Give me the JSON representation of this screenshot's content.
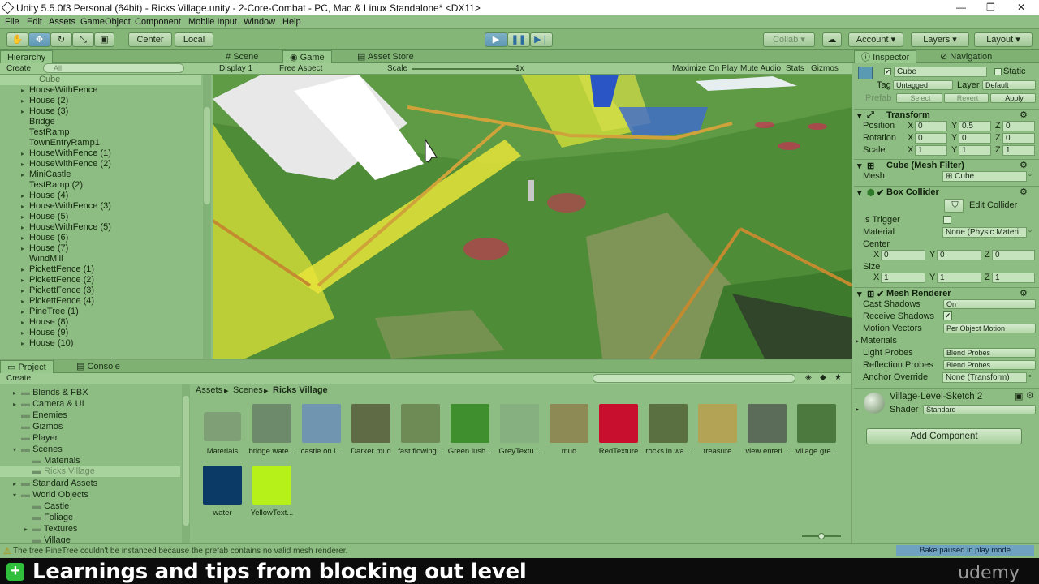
{
  "window": {
    "title": "Unity 5.5.0f3 Personal (64bit) - Ricks Village.unity - 2-Core-Combat - PC, Mac & Linux Standalone* <DX11>",
    "controls": [
      "—",
      "❐",
      "✕"
    ]
  },
  "menu": [
    "File",
    "Edit",
    "Assets",
    "GameObject",
    "Component",
    "Mobile Input",
    "Window",
    "Help"
  ],
  "toolbar": {
    "pivot_center": "Center",
    "pivot_local": "Local",
    "collab": "Collab",
    "account": "Account",
    "layers": "Layers",
    "layout": "Layout"
  },
  "hierarchy": {
    "tab": "Hierarchy",
    "create": "Create",
    "search_placeholder": "All",
    "selected": "Cube",
    "items": [
      {
        "label": "HouseWithFence",
        "expandable": true
      },
      {
        "label": "House (2)",
        "expandable": true
      },
      {
        "label": "House (3)",
        "expandable": true
      },
      {
        "label": "Bridge",
        "expandable": false
      },
      {
        "label": "TestRamp",
        "expandable": false
      },
      {
        "label": "TownEntryRamp1",
        "expandable": false
      },
      {
        "label": "HouseWithFence (1)",
        "expandable": true
      },
      {
        "label": "HouseWithFence (2)",
        "expandable": true
      },
      {
        "label": "MiniCastle",
        "expandable": true
      },
      {
        "label": "TestRamp (2)",
        "expandable": false
      },
      {
        "label": "House (4)",
        "expandable": true
      },
      {
        "label": "HouseWithFence (3)",
        "expandable": true
      },
      {
        "label": "House (5)",
        "expandable": true
      },
      {
        "label": "HouseWithFence (5)",
        "expandable": true
      },
      {
        "label": "House (6)",
        "expandable": true
      },
      {
        "label": "House (7)",
        "expandable": true
      },
      {
        "label": "WindMill",
        "expandable": false
      },
      {
        "label": "PickettFence (1)",
        "expandable": true
      },
      {
        "label": "PickettFence (2)",
        "expandable": true
      },
      {
        "label": "PickettFence (3)",
        "expandable": true
      },
      {
        "label": "PickettFence (4)",
        "expandable": true
      },
      {
        "label": "PineTree (1)",
        "expandable": true
      },
      {
        "label": "House (8)",
        "expandable": true
      },
      {
        "label": "House (9)",
        "expandable": true
      },
      {
        "label": "House (10)",
        "expandable": true
      }
    ]
  },
  "center_tabs": {
    "scene": "Scene",
    "game": "Game",
    "asset_store": "Asset Store"
  },
  "game_bar": {
    "display": "Display 1",
    "aspect": "Free Aspect",
    "scale_label": "Scale",
    "scale_value": "1x",
    "maximize": "Maximize On Play",
    "mute": "Mute Audio",
    "stats": "Stats",
    "gizmos": "Gizmos"
  },
  "inspector": {
    "tab": "Inspector",
    "nav_tab": "Navigation",
    "object_name": "Cube",
    "static_label": "Static",
    "tag_label": "Tag",
    "tag_value": "Untagged",
    "layer_label": "Layer",
    "layer_value": "Default",
    "prefab_label": "Prefab",
    "select": "Select",
    "revert": "Revert",
    "apply": "Apply",
    "transform": {
      "title": "Transform",
      "rows": [
        {
          "label": "Position",
          "x": "0",
          "y": "0.5",
          "z": "0"
        },
        {
          "label": "Rotation",
          "x": "0",
          "y": "0",
          "z": "0"
        },
        {
          "label": "Scale",
          "x": "1",
          "y": "1",
          "z": "1"
        }
      ]
    },
    "mesh_filter": {
      "title": "Cube (Mesh Filter)",
      "mesh_label": "Mesh",
      "mesh_value": "Cube"
    },
    "box_collider": {
      "title": "Box Collider",
      "edit": "Edit Collider",
      "is_trigger": "Is Trigger",
      "material_label": "Material",
      "material_value": "None (Physic Materi.",
      "center_label": "Center",
      "center": {
        "x": "0",
        "y": "0",
        "z": "0"
      },
      "size_label": "Size",
      "size": {
        "x": "1",
        "y": "1",
        "z": "1"
      }
    },
    "mesh_renderer": {
      "title": "Mesh Renderer",
      "rows": [
        {
          "label": "Cast Shadows",
          "value": "On",
          "kind": "dropdown"
        },
        {
          "label": "Receive Shadows",
          "value": "✔",
          "kind": "check"
        },
        {
          "label": "Motion Vectors",
          "value": "Per Object Motion",
          "kind": "dropdown"
        },
        {
          "label": "Materials",
          "value": "",
          "kind": "fold"
        },
        {
          "label": "Light Probes",
          "value": "Blend Probes",
          "kind": "dropdown"
        },
        {
          "label": "Reflection Probes",
          "value": "Blend Probes",
          "kind": "dropdown"
        },
        {
          "label": "Anchor Override",
          "value": "None (Transform)",
          "kind": "field"
        }
      ]
    },
    "material": {
      "name": "Village-Level-Sketch 2",
      "shader_label": "Shader",
      "shader_value": "Standard"
    },
    "add_component": "Add Component"
  },
  "project": {
    "tab": "Project",
    "console_tab": "Console",
    "create": "Create",
    "tree": [
      {
        "label": "Blends & FBX",
        "depth": 1,
        "arrow": "▸"
      },
      {
        "label": "Camera & UI",
        "depth": 1,
        "arrow": "▸"
      },
      {
        "label": "Enemies",
        "depth": 1,
        "arrow": ""
      },
      {
        "label": "Gizmos",
        "depth": 1,
        "arrow": ""
      },
      {
        "label": "Player",
        "depth": 1,
        "arrow": ""
      },
      {
        "label": "Scenes",
        "depth": 1,
        "arrow": "▾"
      },
      {
        "label": "Materials",
        "depth": 2,
        "arrow": ""
      },
      {
        "label": "Ricks Village",
        "depth": 2,
        "arrow": ""
      },
      {
        "label": "Standard Assets",
        "depth": 1,
        "arrow": "▸"
      },
      {
        "label": "World Objects",
        "depth": 1,
        "arrow": "▾"
      },
      {
        "label": "Castle",
        "depth": 2,
        "arrow": ""
      },
      {
        "label": "Foliage",
        "depth": 2,
        "arrow": ""
      },
      {
        "label": "Textures",
        "depth": 2,
        "arrow": "▸"
      },
      {
        "label": "Village",
        "depth": 2,
        "arrow": ""
      }
    ],
    "breadcrumb": [
      "Assets",
      "Scenes",
      "Ricks Village"
    ],
    "assets": [
      {
        "label": "Materials",
        "color": "#7fa077",
        "folder": true
      },
      {
        "label": "bridge wate...",
        "color": "#6d8a6a"
      },
      {
        "label": "castle on l...",
        "color": "#6f95b0"
      },
      {
        "label": "Darker mud",
        "color": "#5f6b45"
      },
      {
        "label": "fast flowing...",
        "color": "#6f8b55"
      },
      {
        "label": "Green lush...",
        "color": "#3f8f2f"
      },
      {
        "label": "GreyTextu...",
        "color": "#86b07f"
      },
      {
        "label": "mud",
        "color": "#8e8a55"
      },
      {
        "label": "RedTexture",
        "color": "#c8102e"
      },
      {
        "label": "rocks in wa...",
        "color": "#5b7040"
      },
      {
        "label": "treasure",
        "color": "#b3a455"
      },
      {
        "label": "view enteri...",
        "color": "#5b6d58"
      },
      {
        "label": "village gre...",
        "color": "#4c7a3e"
      },
      {
        "label": "water",
        "color": "#0c3a66"
      },
      {
        "label": "YellowText...",
        "color": "#b6f21a"
      }
    ]
  },
  "status": {
    "message": "The tree PineTree couldn't be instanced because the prefab contains no valid mesh renderer.",
    "bake": "Bake paused in play mode"
  },
  "caption": {
    "text": "Learnings and tips from blocking out level",
    "brand": "udemy"
  }
}
